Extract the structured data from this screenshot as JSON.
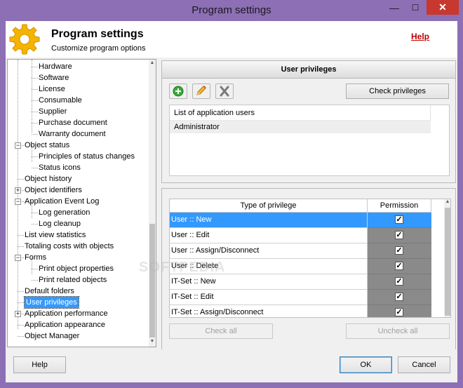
{
  "window": {
    "title": "Program settings",
    "minimize": "—",
    "maximize": "☐",
    "close": "✕"
  },
  "header": {
    "title": "Program settings",
    "subtitle": "Customize program options",
    "help_link": "Help"
  },
  "tree": {
    "items": [
      {
        "label": "Hardware",
        "level": 2
      },
      {
        "label": "Software",
        "level": 2
      },
      {
        "label": "License",
        "level": 2
      },
      {
        "label": "Consumable",
        "level": 2
      },
      {
        "label": "Supplier",
        "level": 2
      },
      {
        "label": "Purchase document",
        "level": 2
      },
      {
        "label": "Warranty document",
        "level": 2
      },
      {
        "label": "Object status",
        "level": 1,
        "expander": "minus"
      },
      {
        "label": "Principles of status changes",
        "level": 2
      },
      {
        "label": "Status icons",
        "level": 2
      },
      {
        "label": "Object history",
        "level": 1
      },
      {
        "label": "Object identifiers",
        "level": 1,
        "expander": "plus"
      },
      {
        "label": "Application Event Log",
        "level": 1,
        "expander": "minus"
      },
      {
        "label": "Log generation",
        "level": 2
      },
      {
        "label": "Log cleanup",
        "level": 2
      },
      {
        "label": "List view statistics",
        "level": 1
      },
      {
        "label": "Totaling costs with objects",
        "level": 1
      },
      {
        "label": "Forms",
        "level": 1,
        "expander": "minus"
      },
      {
        "label": "Print object properties",
        "level": 2
      },
      {
        "label": "Print related objects",
        "level": 2
      },
      {
        "label": "Default folders",
        "level": 1
      },
      {
        "label": "User privileges",
        "level": 1,
        "selected": true
      },
      {
        "label": "Application performance",
        "level": 1,
        "expander": "plus"
      },
      {
        "label": "Application appearance",
        "level": 1
      },
      {
        "label": "Object Manager",
        "level": 1
      }
    ]
  },
  "panel": {
    "title": "User privileges",
    "check_privileges": "Check privileges",
    "add_icon": "plus-circle-icon",
    "edit_icon": "pencil-icon",
    "delete_icon": "x-icon"
  },
  "users": {
    "header": "List of application users",
    "rows": [
      "Administrator"
    ]
  },
  "privileges": {
    "col_type": "Type of privilege",
    "col_permission": "Permission",
    "rows": [
      {
        "type": "User :: New",
        "permission": true,
        "selected": true
      },
      {
        "type": "User :: Edit",
        "permission": true
      },
      {
        "type": "User :: Assign/Disconnect",
        "permission": true
      },
      {
        "type": "User :: Delete",
        "permission": true
      },
      {
        "type": "IT-Set :: New",
        "permission": true
      },
      {
        "type": "IT-Set :: Edit",
        "permission": true
      },
      {
        "type": "IT-Set :: Assign/Disconnect",
        "permission": true
      }
    ],
    "check_all": "Check all",
    "uncheck_all": "Uncheck all"
  },
  "footer": {
    "help": "Help",
    "ok": "OK",
    "cancel": "Cancel"
  },
  "colors": {
    "titlebar": "#8c6fb5",
    "selection": "#3399ff",
    "close_button": "#c7382f",
    "help_link": "#c00000"
  }
}
